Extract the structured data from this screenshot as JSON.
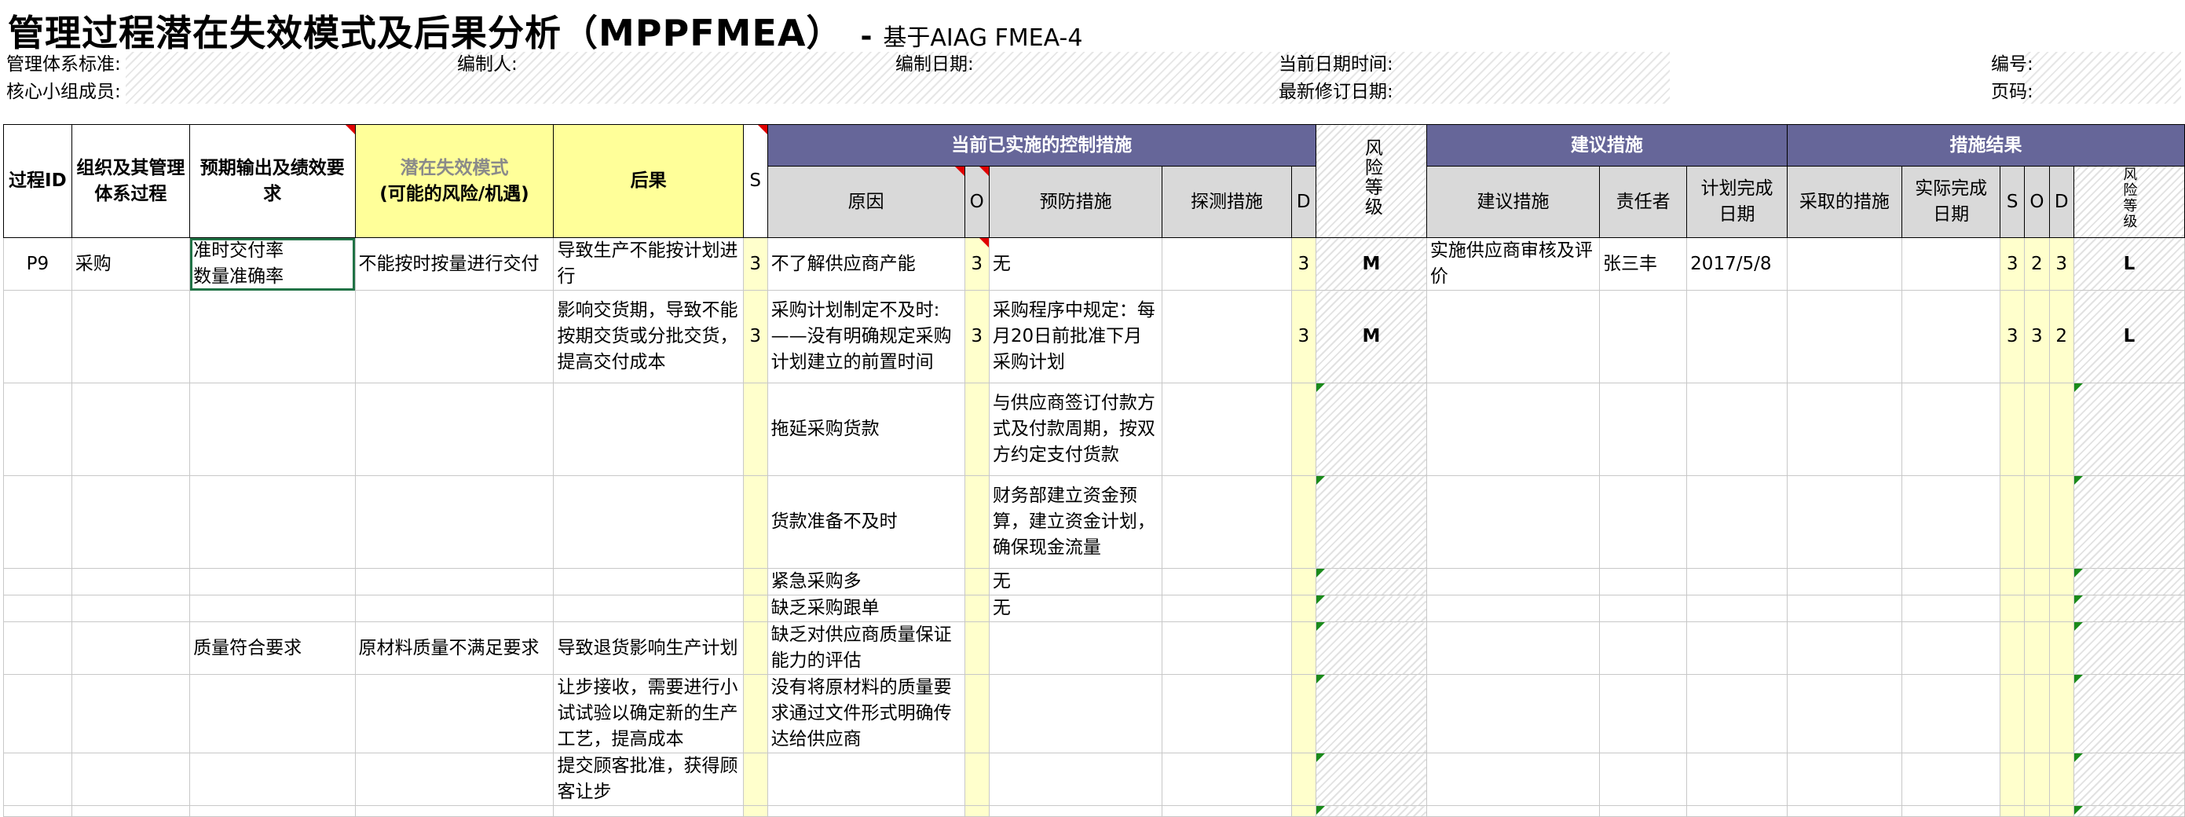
{
  "header": {
    "title": "管理过程潜在失效模式及后果分析（MPPFMEA）",
    "dash": "-",
    "subtitle": "基于AIAG FMEA-4",
    "fields": {
      "mgmt_standard": "管理体系标准:",
      "prepared_by": "编制人:",
      "prepared_date": "编制日期:",
      "current_datetime": "当前日期时间:",
      "number": "编号:",
      "core_team": "核心小组成员:",
      "latest_revision": "最新修订日期:",
      "page_no": "页码:"
    }
  },
  "columns": {
    "process_id": "过程ID",
    "org_process": "组织及其管理体系过程",
    "expected_output": "预期输出及绩效要求",
    "failure_mode": "潜在失效模式",
    "failure_mode_sub": "(可能的风险/机遇)",
    "effect": "后果",
    "s": "S",
    "current_controls": "当前已实施的控制措施",
    "cause": "原因",
    "o": "O",
    "prevention": "预防措施",
    "detection": "探测措施",
    "d": "D",
    "risk_level": "风险等级",
    "recommended_group": "建议措施",
    "recommended": "建议措施",
    "responsible": "责任者",
    "planned_date": "计划完成日期",
    "results": "措施结果",
    "actions_taken": "采取的措施",
    "actual_date": "实际完成日期",
    "rs": "S",
    "ro": "O",
    "rd": "D",
    "r_risk": "风险等级"
  },
  "rows": [
    {
      "id": "P9",
      "org": "采购",
      "output": "准时交付率\n数量准确率",
      "mode": "不能按时按量进行交付",
      "effect": "导致生产不能按计划进行",
      "s": "3",
      "cause": "不了解供应商产能",
      "o": "3",
      "prevention": "无",
      "detection": "",
      "d": "3",
      "risk": "M",
      "rec": "实施供应商审核及评价",
      "resp": "张三丰",
      "plan": "2017/5/8",
      "taken": "",
      "actual": "",
      "rs": "3",
      "ro": "2",
      "rd": "3",
      "rr": "L"
    },
    {
      "id": "",
      "org": "",
      "output": "",
      "mode": "",
      "effect": "影响交货期，导致不能按期交货或分批交货，提高交付成本",
      "s": "3",
      "cause": "采购计划制定不及时:\n——没有明确规定采购计划建立的前置时间",
      "o": "3",
      "prevention": "采购程序中规定：每月20日前批准下月采购计划",
      "detection": "",
      "d": "3",
      "risk": "M",
      "rec": "",
      "resp": "",
      "plan": "",
      "taken": "",
      "actual": "",
      "rs": "3",
      "ro": "3",
      "rd": "2",
      "rr": "L"
    },
    {
      "id": "",
      "org": "",
      "output": "",
      "mode": "",
      "effect": "",
      "s": "",
      "cause": "拖延采购货款",
      "o": "",
      "prevention": "与供应商签订付款方式及付款周期，按双方约定支付货款",
      "detection": "",
      "d": "",
      "risk": "",
      "rec": "",
      "resp": "",
      "plan": "",
      "taken": "",
      "actual": "",
      "rs": "",
      "ro": "",
      "rd": "",
      "rr": ""
    },
    {
      "id": "",
      "org": "",
      "output": "",
      "mode": "",
      "effect": "",
      "s": "",
      "cause": "货款准备不及时",
      "o": "",
      "prevention": "财务部建立资金预算，建立资金计划，确保现金流量",
      "detection": "",
      "d": "",
      "risk": "",
      "rec": "",
      "resp": "",
      "plan": "",
      "taken": "",
      "actual": "",
      "rs": "",
      "ro": "",
      "rd": "",
      "rr": ""
    },
    {
      "id": "",
      "org": "",
      "output": "",
      "mode": "",
      "effect": "",
      "s": "",
      "cause": "紧急采购多",
      "o": "",
      "prevention": "无",
      "detection": "",
      "d": "",
      "risk": "",
      "rec": "",
      "resp": "",
      "plan": "",
      "taken": "",
      "actual": "",
      "rs": "",
      "ro": "",
      "rd": "",
      "rr": ""
    },
    {
      "id": "",
      "org": "",
      "output": "",
      "mode": "",
      "effect": "",
      "s": "",
      "cause": "缺乏采购跟单",
      "o": "",
      "prevention": "无",
      "detection": "",
      "d": "",
      "risk": "",
      "rec": "",
      "resp": "",
      "plan": "",
      "taken": "",
      "actual": "",
      "rs": "",
      "ro": "",
      "rd": "",
      "rr": ""
    },
    {
      "id": "",
      "org": "",
      "output": "质量符合要求",
      "mode": "原材料质量不满足要求",
      "effect": "导致退货影响生产计划",
      "s": "",
      "cause": "缺乏对供应商质量保证能力的评估",
      "o": "",
      "prevention": "",
      "detection": "",
      "d": "",
      "risk": "",
      "rec": "",
      "resp": "",
      "plan": "",
      "taken": "",
      "actual": "",
      "rs": "",
      "ro": "",
      "rd": "",
      "rr": ""
    },
    {
      "id": "",
      "org": "",
      "output": "",
      "mode": "",
      "effect": "让步接收，需要进行小试试验以确定新的生产工艺，提高成本",
      "s": "",
      "cause": "没有将原材料的质量要求通过文件形式明确传达给供应商",
      "o": "",
      "prevention": "",
      "detection": "",
      "d": "",
      "risk": "",
      "rec": "",
      "resp": "",
      "plan": "",
      "taken": "",
      "actual": "",
      "rs": "",
      "ro": "",
      "rd": "",
      "rr": ""
    },
    {
      "id": "",
      "org": "",
      "output": "",
      "mode": "",
      "effect": "提交顾客批准，获得顾客让步",
      "s": "",
      "cause": "",
      "o": "",
      "prevention": "",
      "detection": "",
      "d": "",
      "risk": "",
      "rec": "",
      "resp": "",
      "plan": "",
      "taken": "",
      "actual": "",
      "rs": "",
      "ro": "",
      "rd": "",
      "rr": ""
    },
    {
      "id": "",
      "org": "",
      "output": "",
      "mode": "",
      "effect": "",
      "s": "",
      "cause": "",
      "o": "",
      "prevention": "",
      "detection": "",
      "d": "",
      "risk": "",
      "rec": "",
      "resp": "",
      "plan": "",
      "taken": "",
      "actual": "",
      "rs": "",
      "ro": "",
      "rd": "",
      "rr": ""
    }
  ]
}
